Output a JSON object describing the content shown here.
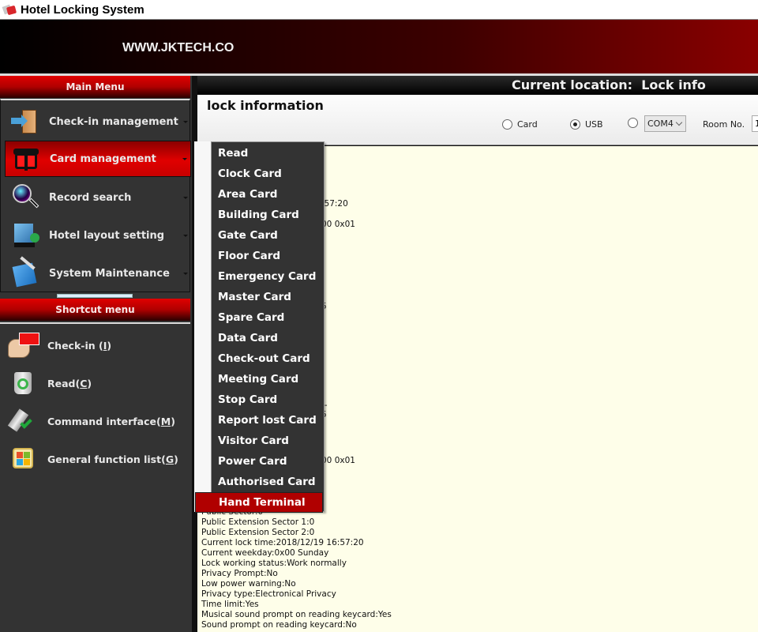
{
  "window": {
    "title": "Hotel Locking System",
    "icon": "app-card-icon"
  },
  "banner": {
    "text": "WWW.JKTECH.CO"
  },
  "sidebar": {
    "main_menu_title": "Main Menu",
    "main_menu": [
      {
        "label": "Check-in management",
        "icon": "door-arrow-icon",
        "active": false
      },
      {
        "label": "Card management",
        "icon": "card-reader-icon",
        "active": true
      },
      {
        "label": "Record search",
        "icon": "magnifier-icon",
        "active": false
      },
      {
        "label": "Hotel layout setting",
        "icon": "hotel-building-icon",
        "active": false
      },
      {
        "label": "System Maintenance",
        "icon": "maintenance-tools-icon",
        "active": false
      }
    ],
    "shortcut_title": "Shortcut menu",
    "shortcuts": [
      {
        "label": "Check-in ",
        "key": "I",
        "suffix": "",
        "icon": "hand-card-icon"
      },
      {
        "label": "Read",
        "key": "C",
        "suffix": "",
        "icon": "recycle-bin-icon"
      },
      {
        "label": "Command interface",
        "key": "M",
        "suffix": "",
        "icon": "plug-check-icon"
      },
      {
        "label": "General function list",
        "key": "G",
        "suffix": "",
        "icon": "tiles-icon"
      }
    ]
  },
  "location": {
    "label": "Current location:",
    "value": "Lock info"
  },
  "lock_panel": {
    "title": "lock information",
    "radios": [
      {
        "label": "Card",
        "selected": false
      },
      {
        "label": "USB",
        "selected": true
      },
      {
        "label": "",
        "selected": false
      }
    ],
    "com_port": "COM4",
    "room_label": "Room No.",
    "room_value": "1"
  },
  "info_partial": [
    {
      "text": ":57:20"
    },
    {
      "text": "00  0x01"
    },
    {
      "text": "5"
    },
    {
      "text": "--"
    },
    {
      "text": "5"
    },
    {
      "text": "00  0x01"
    }
  ],
  "info_lines": [
    "Public Sector:0",
    "Public Extension Sector 1:0",
    "Public Extension Sector 2:0",
    "Current lock time:2018/12/19 16:57:20",
    "Current weekday:0x00  Sunday",
    "Lock working status:Work normally",
    "Privacy Prompt:No",
    "Low power warning:No",
    "Privacy type:Electronical Privacy",
    "Time limit:Yes",
    "Musical sound prompt on reading keycard:Yes",
    "Sound prompt on reading keycard:No"
  ],
  "card_menu": {
    "items": [
      "Read",
      "Clock Card",
      "Area Card",
      "Building Card",
      "Gate Card",
      "Floor Card",
      "Emergency Card",
      "Master Card",
      "Spare Card",
      "Data Card",
      "Check-out Card",
      "Meeting Card",
      "Stop Card",
      "Report lost Card",
      "Visitor Card",
      "Power Card",
      "Authorised Card",
      "Hand Terminal"
    ],
    "highlighted": "Hand Terminal"
  },
  "colors": {
    "accent_red": "#e00000",
    "menu_dark": "#333333",
    "info_bg": "#fefee9"
  }
}
